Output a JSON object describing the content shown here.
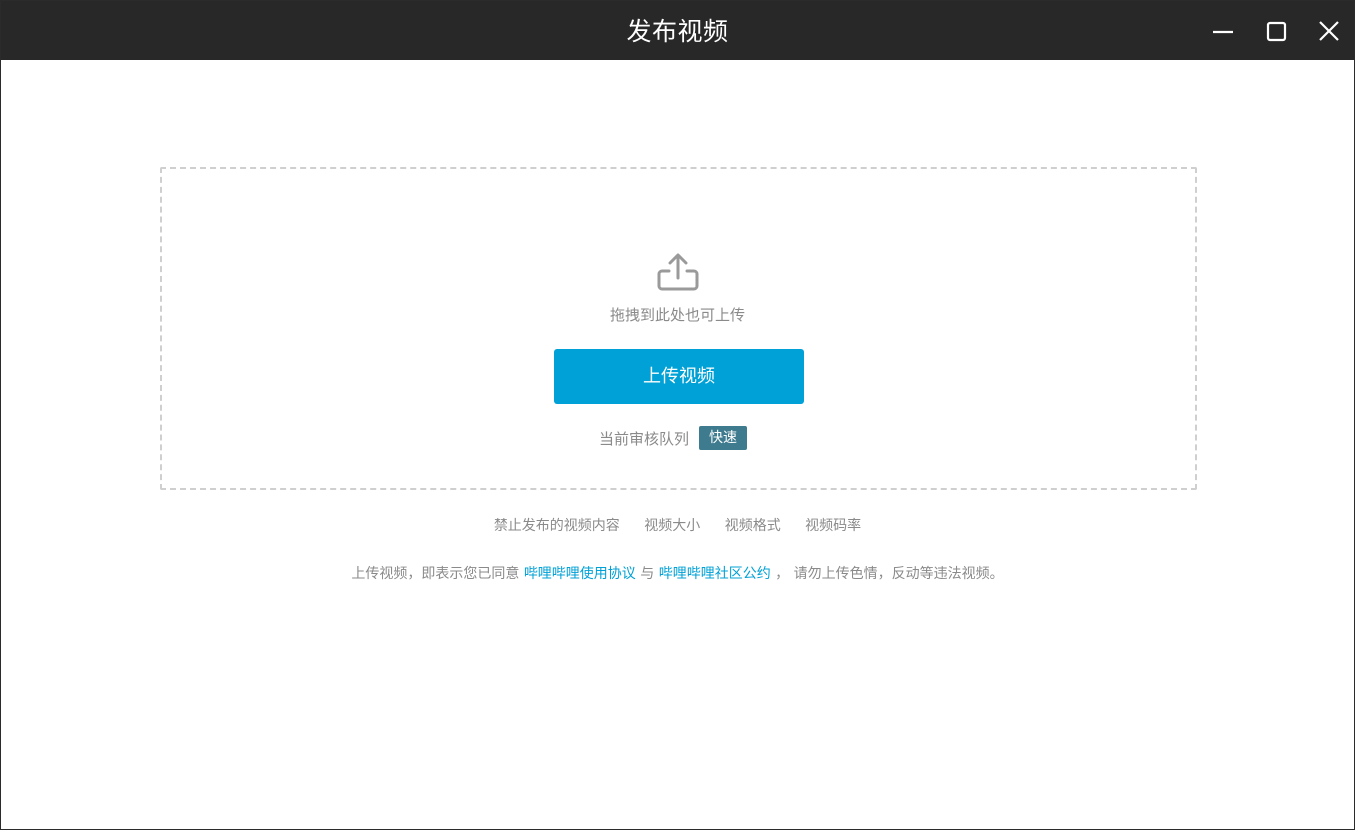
{
  "window": {
    "title": "发布视频",
    "controls": {
      "minimize_icon": "minimize-icon",
      "maximize_icon": "maximize-icon",
      "close_icon": "close-icon"
    }
  },
  "dropzone": {
    "icon": "upload-icon",
    "hint": "拖拽到此处也可上传",
    "upload_button_label": "上传视频",
    "queue_label": "当前审核队列",
    "queue_status": "快速"
  },
  "rules_links": [
    "禁止发布的视频内容",
    "视频大小",
    "视频格式",
    "视频码率"
  ],
  "agreement": {
    "prefix": "上传视频，即表示您已同意",
    "link1": "哔哩哔哩使用协议",
    "connector": "与",
    "link2": "哔哩哔哩社区公约",
    "suffix": "， 请勿上传色情，反动等违法视频。"
  },
  "colors": {
    "titlebar_bg": "#282828",
    "accent": "#00a1d6",
    "badge_bg": "#3e7b8f",
    "muted_text": "#8a8a8a"
  }
}
